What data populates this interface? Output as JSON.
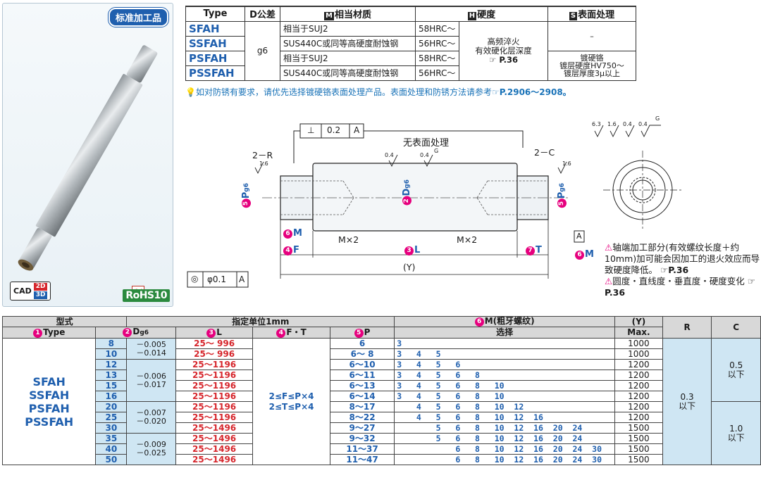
{
  "badges": {
    "standard_label": "标准加工品",
    "cad_label": "CAD",
    "cad_2d": "2D",
    "cad_3d": "3D",
    "made_label": "制",
    "rohs_label": "RoHS10"
  },
  "spec_table": {
    "headers": [
      "Type",
      "D公差",
      "相当材质",
      "硬度",
      "表面处理"
    ],
    "header_icons": [
      "",
      "",
      "M",
      "H",
      "S"
    ],
    "tolerance": "g6",
    "hardness_note": [
      "高频淬火",
      "有效硬化层深度",
      "P.36"
    ],
    "rows": [
      {
        "type": "SFAH",
        "material": "相当于SUJ2",
        "hrc": "58HRC～",
        "surface": "–"
      },
      {
        "type": "SSFAH",
        "material": "SUS440C或同等高硬度耐蚀钢",
        "hrc": "56HRC～",
        "surface": ""
      },
      {
        "type": "PSFAH",
        "material": "相当于SUJ2",
        "hrc": "58HRC～",
        "surface": ""
      },
      {
        "type": "PSSFAH",
        "material": "SUS440C或同等高硬度耐蚀钢",
        "hrc": "56HRC～",
        "surface": ""
      }
    ],
    "chrome_surface": [
      "镀硬铬",
      "镀层硬度HV750～",
      "镀层厚度3μ以上"
    ]
  },
  "note_rust": "如对防锈有要求，请优先选择镀硬铬表面处理产品。表面处理和防锈方法请参考",
  "note_rust_ref": "P.2906～2908。",
  "drawing": {
    "perp_tol": "⊥ 0.2 A",
    "perp_sym": "⊥",
    "perp_val": "0.2",
    "perp_datum": "A",
    "no_surface": "无表面处理",
    "left_chamfer": "2－R",
    "right_chamfer": "2－C",
    "left_thread": "M×2",
    "right_thread": "M×2",
    "label_F": "F",
    "label_L": "L",
    "label_T": "T",
    "label_Y": "(Y)",
    "label_M": "M",
    "label_P": "P",
    "label_P_sub": "g6",
    "label_D": "D",
    "label_D_sub": "g6",
    "conc_sym": "◎",
    "conc_val": "φ0.1",
    "conc_datum": "A",
    "datum_A": "A",
    "rough_16": "1.6",
    "rough_04": "0.4",
    "rough_63": "6.3",
    "rough_G": "G",
    "num_F": "4",
    "num_L": "3",
    "num_T": "7",
    "num_M": "6",
    "num_P": "5",
    "num_D": "2",
    "side_note_1": "轴端加工部分(有效螺纹长度＋约10mm)加可能会因加工的退火效应而导致硬度降低。",
    "side_note_1_ref": "P.36",
    "side_note_2": "圆度・直线度・垂直度・硬度变化",
    "side_note_2_ref": "P.36"
  },
  "main_table": {
    "header_group_1": "型式",
    "header_group_2": "指定单位1mm",
    "header_group_3": "M(粗牙螺纹)",
    "header_group_3_sub": "选择",
    "header_Y": "(Y)",
    "header_Y_sub": "Max.",
    "header_R": "R",
    "header_C": "C",
    "col_type": "Type",
    "col_D": "D",
    "col_D_sub": "g6",
    "col_L": "L",
    "col_FT": "F・T",
    "col_P": "P",
    "types": [
      "SFAH",
      "SSFAH",
      "PSFAH",
      "PSSFAH"
    ],
    "ft_rule_1": "2≤F≤P×4",
    "ft_rule_2": "2≤T≤P×4",
    "r_value": "0.3",
    "r_unit": "以下",
    "c_values": [
      {
        "value": "0.5",
        "unit": "以下"
      },
      {
        "value": "1.0",
        "unit": "以下"
      }
    ],
    "tol_groups": [
      {
        "upper": "－0.005",
        "lower": "－0.014"
      },
      {
        "upper": "－0.006",
        "lower": "－0.017"
      },
      {
        "upper": "－0.007",
        "lower": "－0.020"
      },
      {
        "upper": "－0.009",
        "lower": "－0.025"
      }
    ],
    "rows": [
      {
        "d": "8",
        "l": "25～ 996",
        "p": "6",
        "m": "3",
        "y": "1000"
      },
      {
        "d": "10",
        "l": "25～ 996",
        "p": "6～ 8",
        "m": "3   4   5",
        "y": "1000"
      },
      {
        "d": "12",
        "l": "25～1196",
        "p": "6～10",
        "m": "3   4   5   6",
        "y": "1200"
      },
      {
        "d": "13",
        "l": "25～1196",
        "p": "6～11",
        "m": "3   4   5   6   8",
        "y": "1200"
      },
      {
        "d": "15",
        "l": "25～1196",
        "p": "6～13",
        "m": "3   4   5   6   8   10",
        "y": "1200"
      },
      {
        "d": "16",
        "l": "25～1196",
        "p": "6～14",
        "m": "3   4   5   6   8   10",
        "y": "1200"
      },
      {
        "d": "20",
        "l": "25～1196",
        "p": "8～17",
        "m": "    4   5   6   8   10  12",
        "y": "1200"
      },
      {
        "d": "25",
        "l": "25～1196",
        "p": "8～22",
        "m": "    4   5   6   8   10  12  16",
        "y": "1200"
      },
      {
        "d": "30",
        "l": "25～1496",
        "p": "9～27",
        "m": "        5   6   8   10  12  16  20  24",
        "y": "1500"
      },
      {
        "d": "35",
        "l": "25～1496",
        "p": "9～32",
        "m": "        5   6   8   10  12  16  20  24",
        "y": "1500"
      },
      {
        "d": "40",
        "l": "25～1496",
        "p": "11～37",
        "m": "            6   8   10  12  16  20  24  30",
        "y": "1500"
      },
      {
        "d": "50",
        "l": "25～1496",
        "p": "11～47",
        "m": "            6   8   10  12  16  20  24  30",
        "y": "1500"
      }
    ]
  }
}
